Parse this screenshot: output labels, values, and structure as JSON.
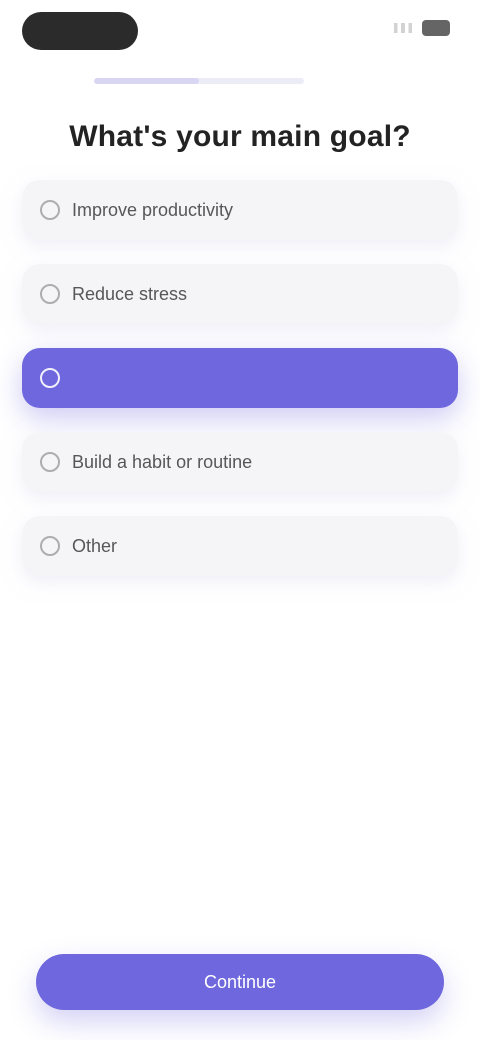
{
  "status_bar": {
    "icons": [
      "signal-icon",
      "battery-icon"
    ]
  },
  "progress": {
    "value": 0.5
  },
  "question": {
    "title": "What's your main goal?"
  },
  "options": [
    {
      "label": "Improve productivity",
      "icon": "target-icon",
      "selected": false
    },
    {
      "label": "Reduce stress",
      "icon": "heart-icon",
      "selected": false
    },
    {
      "label": "",
      "icon": "check-icon",
      "selected": true
    },
    {
      "label": "Build a habit or routine",
      "icon": "calendar-icon",
      "selected": false
    },
    {
      "label": "Other",
      "icon": "more-icon",
      "selected": false
    }
  ],
  "footer": {
    "continue_label": "Continue"
  },
  "colors": {
    "accent": "#6f67dd",
    "option_bg": "#f5f5f7",
    "text": "#232323"
  }
}
